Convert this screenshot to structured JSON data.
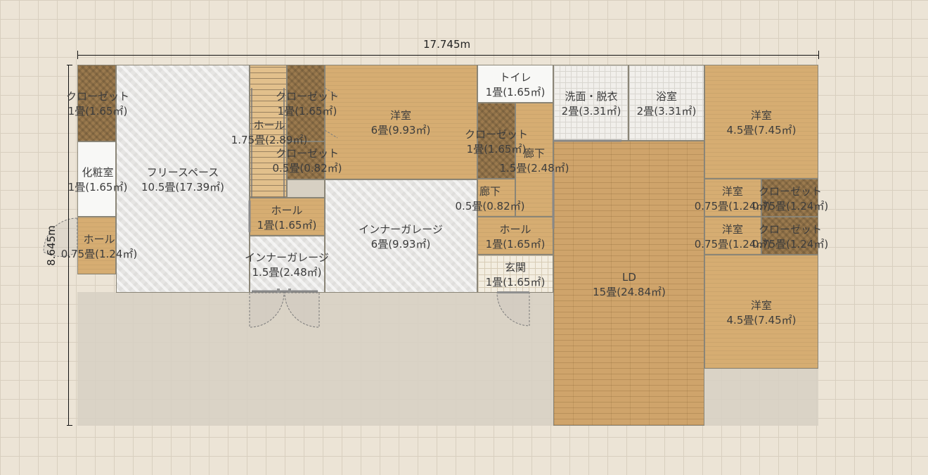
{
  "dimensions": {
    "width_label": "17.745m",
    "height_label": "8.645m"
  },
  "rooms": {
    "closet_a": {
      "name": "クローゼット",
      "area": "1畳(1.65㎡)"
    },
    "closet_b": {
      "name": "クローゼット",
      "area": "1畳(1.65㎡)"
    },
    "hall_stairs": {
      "name": "ホール",
      "area": "1.75畳(2.89㎡)"
    },
    "closet_c": {
      "name": "クローゼット",
      "area": "0.5畳(0.82㎡)"
    },
    "western_1": {
      "name": "洋室",
      "area": "6畳(9.93㎡)"
    },
    "toilet": {
      "name": "トイレ",
      "area": "1畳(1.65㎡)"
    },
    "washroom": {
      "name": "洗面・脱衣",
      "area": "2畳(3.31㎡)"
    },
    "bathroom": {
      "name": "浴室",
      "area": "2畳(3.31㎡)"
    },
    "western_2": {
      "name": "洋室",
      "area": "4.5畳(7.45㎡)"
    },
    "closet_d": {
      "name": "クローゼット",
      "area": "1畳(1.65㎡)"
    },
    "corridor_a": {
      "name": "廊下",
      "area": "1.5畳(2.48㎡)"
    },
    "powder_room": {
      "name": "化粧室",
      "area": "1畳(1.65㎡)"
    },
    "free_space": {
      "name": "フリースペース",
      "area": "10.5畳(17.39㎡)"
    },
    "western_3": {
      "name": "洋室",
      "area": "0.75畳(1.24㎡)"
    },
    "closet_e": {
      "name": "クローゼット",
      "area": "0.75畳(1.24㎡)"
    },
    "corridor_b": {
      "name": "廊下",
      "area": "0.5畳(0.82㎡)"
    },
    "hall_b": {
      "name": "ホール",
      "area": "1畳(1.65㎡)"
    },
    "inner_garage": {
      "name": "インナーガレージ",
      "area": "6畳(9.93㎡)"
    },
    "western_4": {
      "name": "洋室",
      "area": "0.75畳(1.24㎡)"
    },
    "closet_f": {
      "name": "クローゼット",
      "area": "0.75畳(1.24㎡)"
    },
    "hall_c": {
      "name": "ホール",
      "area": "1畳(1.65㎡)"
    },
    "hall_a": {
      "name": "ホール",
      "area": "0.75畳(1.24㎡)"
    },
    "inner_garage_small": {
      "name": "インナーガレージ",
      "area": "1.5畳(2.48㎡)"
    },
    "entrance": {
      "name": "玄関",
      "area": "1畳(1.65㎡)"
    },
    "ld": {
      "name": "LD",
      "area": "15畳(24.84㎡)"
    },
    "western_5": {
      "name": "洋室",
      "area": "4.5畳(7.45㎡)"
    }
  }
}
